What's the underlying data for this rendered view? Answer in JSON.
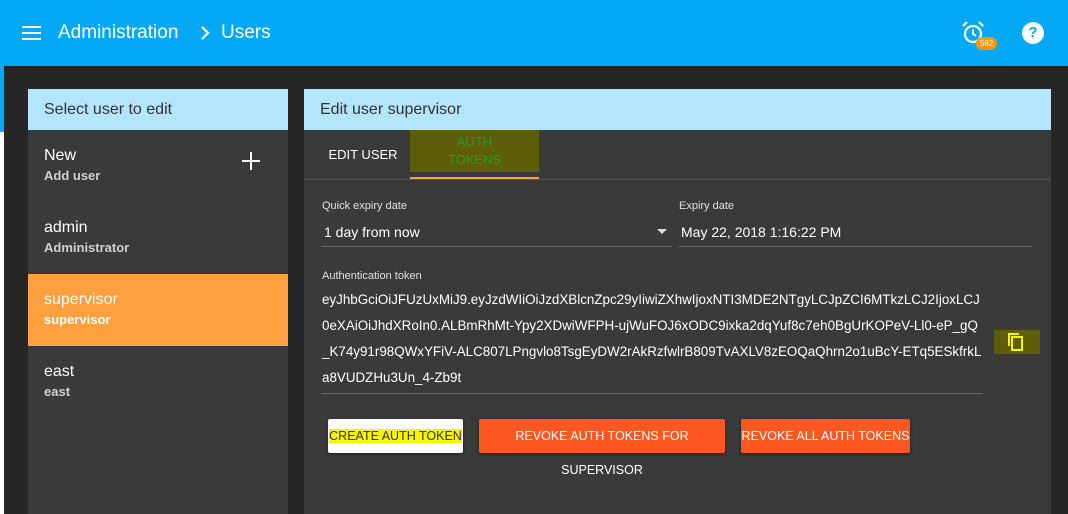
{
  "appbar": {
    "breadcrumb": [
      "Administration",
      "Users"
    ],
    "alarm_count": "582"
  },
  "left_panel": {
    "title": "Select user to edit",
    "users": [
      {
        "name": "New",
        "sub": "Add user"
      },
      {
        "name": "admin",
        "sub": "Administrator"
      },
      {
        "name": "supervisor",
        "sub": "supervisor"
      },
      {
        "name": "east",
        "sub": "east"
      }
    ],
    "selected_user": "supervisor"
  },
  "right_panel": {
    "title": "Edit user supervisor",
    "tabs": [
      "EDIT USER",
      "AUTH TOKENS"
    ],
    "active_tab": "AUTH TOKENS",
    "quick_expiry": {
      "label": "Quick expiry date",
      "value": "1 day from now"
    },
    "expiry": {
      "label": "Expiry date",
      "value": "May 22, 2018 1:16:22 PM"
    },
    "token": {
      "label": "Authentication token",
      "value": "eyJhbGciOiJFUzUxMiJ9.eyJzdWIiOiJzdXBlcnZpc29yIiwiZXhwIjoxNTI3MDE2NTgyLCJpZCI6MTkzLCJ2IjoxLCJ0eXAiOiJhdXRoIn0.ALBmRhMt-Ypy2XDwiWFPH-ujWuFOJ6xODC9ixka2dqYuf8c7eh0BgUrKOPeV-Ll0-eP_gQ_K74y91r98QWxYFiV-ALC807LPngvlo8TsgEyDW2rAkRzfwlrB809TvAXLV8zEOQaQhrn2o1uBcY-ETq5ESkfrkLa8VUDZHu3Un_4-Zb9t"
    },
    "buttons": {
      "create": "CREATE AUTH TOKEN",
      "revoke_user": "REVOKE AUTH TOKENS FOR SUPERVISOR",
      "revoke_all": "REVOKE ALL AUTH TOKENS"
    }
  },
  "colors": {
    "appbar": "#03a9f4",
    "panel_header": "#b3e5fc",
    "accent": "#ffa040",
    "danger": "#ff5722",
    "highlight": "#f5f500"
  }
}
